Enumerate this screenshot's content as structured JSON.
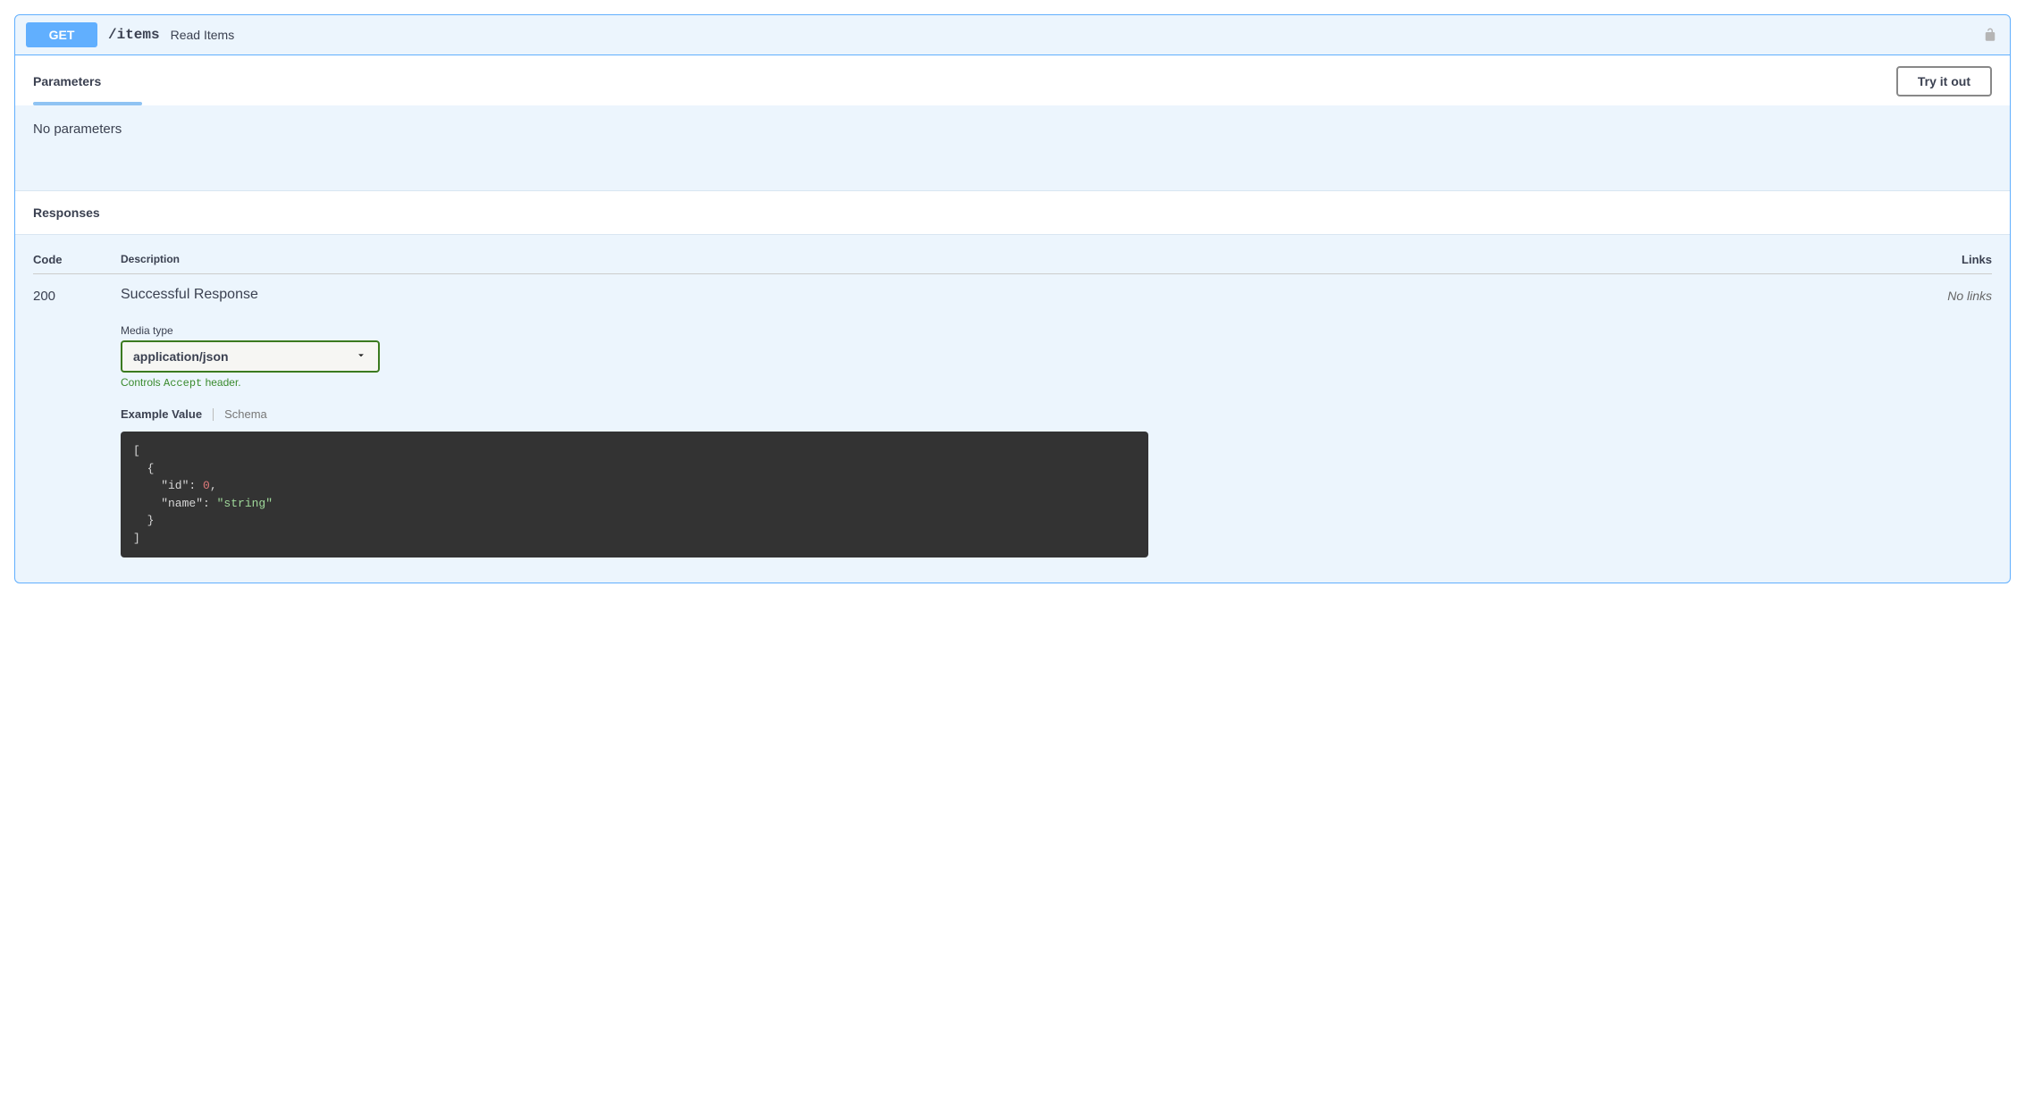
{
  "op": {
    "method": "GET",
    "path": "/items",
    "summary": "Read Items"
  },
  "parameters": {
    "section_title": "Parameters",
    "try_it_label": "Try it out",
    "empty_text": "No parameters"
  },
  "responses": {
    "section_title": "Responses",
    "header_code": "Code",
    "header_desc": "Description",
    "header_links": "Links",
    "rows": [
      {
        "code": "200",
        "description": "Successful Response",
        "links_text": "No links",
        "media_label": "Media type",
        "media_selected": "application/json",
        "accept_prefix": "Controls ",
        "accept_code": "Accept",
        "accept_suffix": " header.",
        "tabs": {
          "example": "Example Value",
          "schema": "Schema"
        },
        "example_json": {
          "open_arr": "[",
          "open_obj": "  {",
          "line_id_key": "    \"id\"",
          "line_id_sep": ": ",
          "line_id_val": "0",
          "line_id_end": ",",
          "line_name_key": "    \"name\"",
          "line_name_sep": ": ",
          "line_name_val": "\"string\"",
          "close_obj": "  }",
          "close_arr": "]"
        }
      }
    ]
  }
}
